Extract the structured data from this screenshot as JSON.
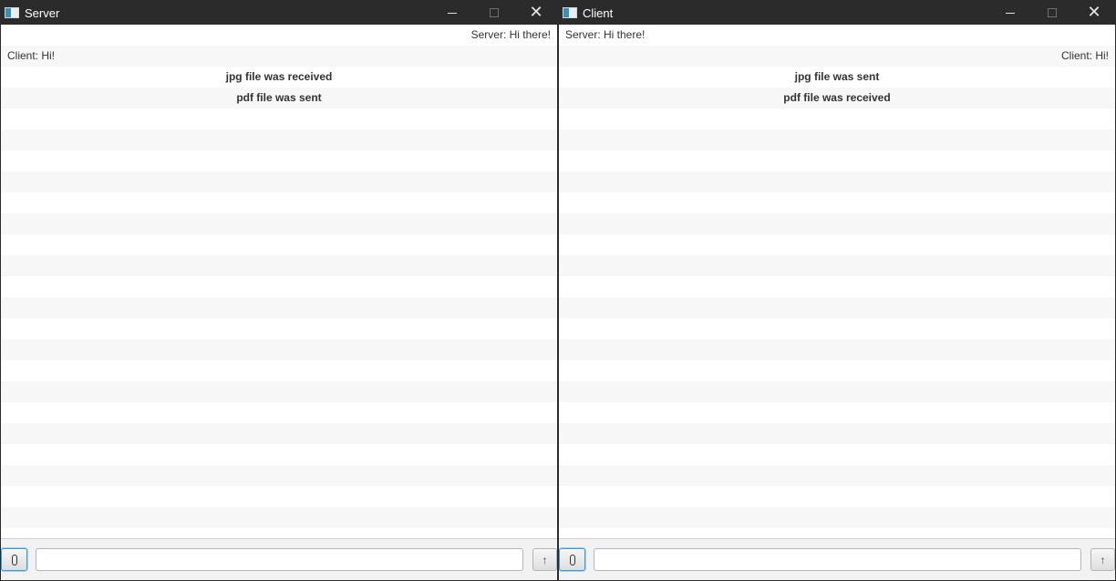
{
  "windows": [
    {
      "title": "Server",
      "messages": [
        {
          "text": "Server: Hi there!",
          "align": "right"
        },
        {
          "text": "Client: Hi!",
          "align": "left"
        },
        {
          "text": "jpg file was received",
          "align": "center"
        },
        {
          "text": "pdf file was sent",
          "align": "center"
        }
      ],
      "input": {
        "value": "",
        "placeholder": ""
      },
      "send_label": "↑"
    },
    {
      "title": "Client",
      "messages": [
        {
          "text": "Server: Hi there!",
          "align": "left"
        },
        {
          "text": "Client: Hi!",
          "align": "right"
        },
        {
          "text": "jpg file was sent",
          "align": "center"
        },
        {
          "text": "pdf file was received",
          "align": "center"
        }
      ],
      "input": {
        "value": "",
        "placeholder": ""
      },
      "send_label": "↑"
    }
  ],
  "icons": {
    "app": "app-window-icon",
    "minimize": "minimize-icon",
    "maximize": "maximize-icon",
    "close": "close-icon",
    "attach": "paperclip-icon",
    "send": "arrow-up-icon"
  },
  "colors": {
    "titlebar": "#2b2b2b",
    "row_even": "#ffffff",
    "row_odd": "#f7f7f7",
    "focus_accent": "#3a9ad9"
  }
}
